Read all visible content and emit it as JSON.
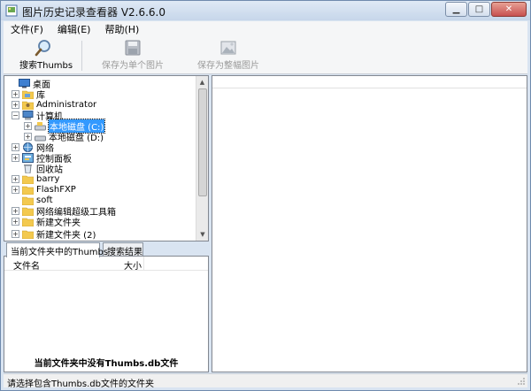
{
  "window": {
    "title": "图片历史记录查看器 V2.6.6.0"
  },
  "menu": [
    {
      "label": "文件(F)"
    },
    {
      "label": "编辑(E)"
    },
    {
      "label": "帮助(H)"
    }
  ],
  "toolbar": {
    "search_label": "搜索Thumbs",
    "save_single_label": "保存为单个图片",
    "save_whole_label": "保存为整幅图片"
  },
  "tree": {
    "items": [
      {
        "label": "桌面",
        "icon": "desktop-icon",
        "expander": "",
        "selected": false
      },
      {
        "label": "库",
        "icon": "library-icon",
        "expander": "+",
        "selected": false
      },
      {
        "label": "Administrator",
        "icon": "user-folder-icon",
        "expander": "+",
        "selected": false
      },
      {
        "label": "计算机",
        "icon": "computer-icon",
        "expander": "−",
        "selected": false
      },
      {
        "label": "本地磁盘 (C:)",
        "icon": "drive-icon",
        "expander": "+",
        "selected": true
      },
      {
        "label": "本地磁盘 (D:)",
        "icon": "drive-icon",
        "expander": "+",
        "selected": false
      },
      {
        "label": "网络",
        "icon": "network-icon",
        "expander": "+",
        "selected": false
      },
      {
        "label": "控制面板",
        "icon": "control-panel-icon",
        "expander": "+",
        "selected": false
      },
      {
        "label": "回收站",
        "icon": "recycle-bin-icon",
        "expander": "",
        "selected": false
      },
      {
        "label": "barry",
        "icon": "folder-icon",
        "expander": "+",
        "selected": false
      },
      {
        "label": "FlashFXP",
        "icon": "folder-icon",
        "expander": "+",
        "selected": false
      },
      {
        "label": "soft",
        "icon": "folder-icon",
        "expander": "",
        "selected": false
      },
      {
        "label": "网络编辑超级工具箱",
        "icon": "folder-icon",
        "expander": "+",
        "selected": false
      },
      {
        "label": "新建文件夹",
        "icon": "folder-icon",
        "expander": "+",
        "selected": false
      },
      {
        "label": "新建文件夹 (2)",
        "icon": "folder-icon",
        "expander": "+",
        "selected": false
      }
    ]
  },
  "tabs": [
    {
      "label": "当前文件夹中的Thumbs",
      "active": true
    },
    {
      "label": "搜索结果",
      "active": false
    }
  ],
  "list": {
    "columns": {
      "name": "文件名",
      "size": "大小"
    },
    "empty_message": "当前文件夹中没有Thumbs.db文件"
  },
  "statusbar": {
    "text": "请选择包含Thumbs.db文件的文件夹"
  },
  "colors": {
    "selection": "#3399ff",
    "titlebar": "#c6d6ea",
    "close_button": "#c75050",
    "folder": "#f3c94f"
  }
}
